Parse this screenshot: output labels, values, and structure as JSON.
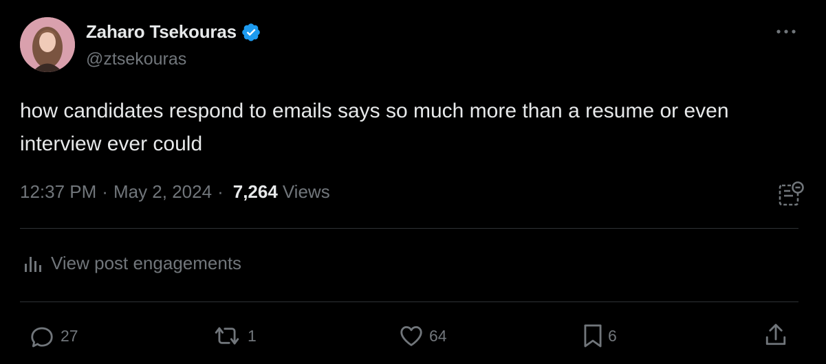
{
  "author": {
    "name": "Zaharo Tsekouras",
    "handle": "@ztsekouras",
    "verified": true
  },
  "post": {
    "text": "how candidates respond to emails says so much more than a resume or even interview ever could",
    "time": "12:37 PM",
    "date": "May 2, 2024",
    "separator": "·",
    "views_count": "7,264",
    "views_label": "Views"
  },
  "engagements": {
    "label": "View post engagements"
  },
  "actions": {
    "replies": "27",
    "reposts": "1",
    "likes": "64",
    "bookmarks": "6"
  },
  "colors": {
    "background": "#000000",
    "text": "#e7e9ea",
    "muted": "#71767b",
    "verified": "#1d9bf0",
    "divider": "#2f3336"
  }
}
